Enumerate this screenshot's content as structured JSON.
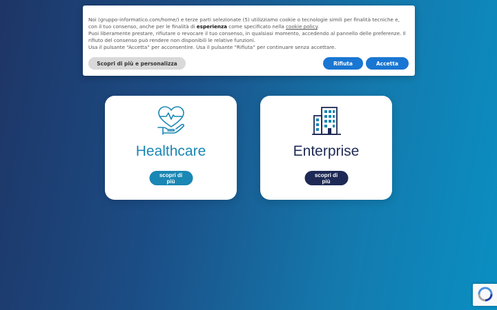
{
  "cookie_banner": {
    "line1_pre": "Noi (gruppo-informatico.com/home/) e terze parti selezionate (5) utilizziamo cookie o tecnologie simili per finalità tecniche e, con il tuo consenso, anche per le finalità di ",
    "line1_bold": "esperienza",
    "line1_mid": " come specificato nella ",
    "line1_link": "cookie policy",
    "line1_end": ".",
    "line2": "Puoi liberamente prestare, rifiutare o revocare il tuo consenso, in qualsiasi momento, accedendo al pannello delle preferenze. Il rifiuto del consenso può rendere non disponibili le relative funzioni.",
    "line3": "Usa il pulsante “Accetta” per acconsentire. Usa il pulsante “Rifiuta” per continuare senza accettare.",
    "customize_label": "Scopri di più e personalizza",
    "reject_label": "Rifiuta",
    "accept_label": "Accetta"
  },
  "cards": {
    "healthcare": {
      "title": "Healthcare",
      "cta": "scopri di più",
      "icon": "heart-hand-icon",
      "color": "#1a87b4"
    },
    "enterprise": {
      "title": "Enterprise",
      "cta": "scopri di più",
      "icon": "building-icon",
      "color": "#1e2a55"
    }
  },
  "recaptcha": {
    "icon": "recaptcha-icon"
  }
}
